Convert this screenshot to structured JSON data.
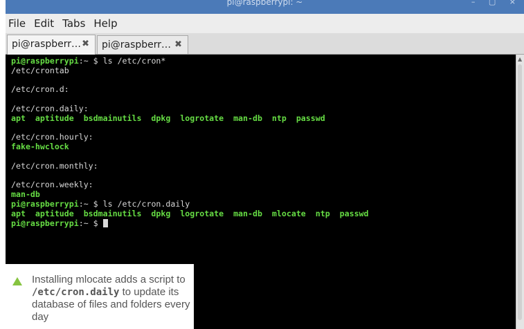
{
  "window": {
    "title": "pi@raspberrypi: ~",
    "controls": "–  ▢  ×"
  },
  "menu": [
    "File",
    "Edit",
    "Tabs",
    "Help"
  ],
  "tabs": [
    {
      "label": "pi@raspberr…",
      "close": "✖"
    },
    {
      "label": "pi@raspberr…",
      "close": "✖"
    }
  ],
  "terminal": {
    "prompt_user": "pi@raspberrypi",
    "prompt_rest": ":~ $ ",
    "cmd1": "ls /etc/cron*",
    "out": {
      "crontab": "/etc/crontab",
      "cron_d": "/etc/cron.d:",
      "cron_daily": "/etc/cron.daily:",
      "daily_files": "apt  aptitude  bsdmainutils  dpkg  logrotate  man-db  ntp  passwd",
      "cron_hourly": "/etc/cron.hourly:",
      "hourly_files": "fake-hwclock",
      "cron_monthly": "/etc/cron.monthly:",
      "cron_weekly": "/etc/cron.weekly:",
      "weekly_files": "man-db"
    },
    "cmd2": "ls /etc/cron.daily",
    "daily_files2": "apt  aptitude  bsdmainutils  dpkg  logrotate  man-db  mlocate  ntp  passwd"
  },
  "caption": {
    "text_before": "Installing mlocate adds a script to ",
    "code": "/etc/cron.daily",
    "text_after": " to update its database of files and folders every day"
  },
  "colors": {
    "titlebar": "#4b7ab8",
    "terminal_bg": "#000000",
    "prompt_green": "#66dd44",
    "caption_triangle": "#86c440"
  }
}
